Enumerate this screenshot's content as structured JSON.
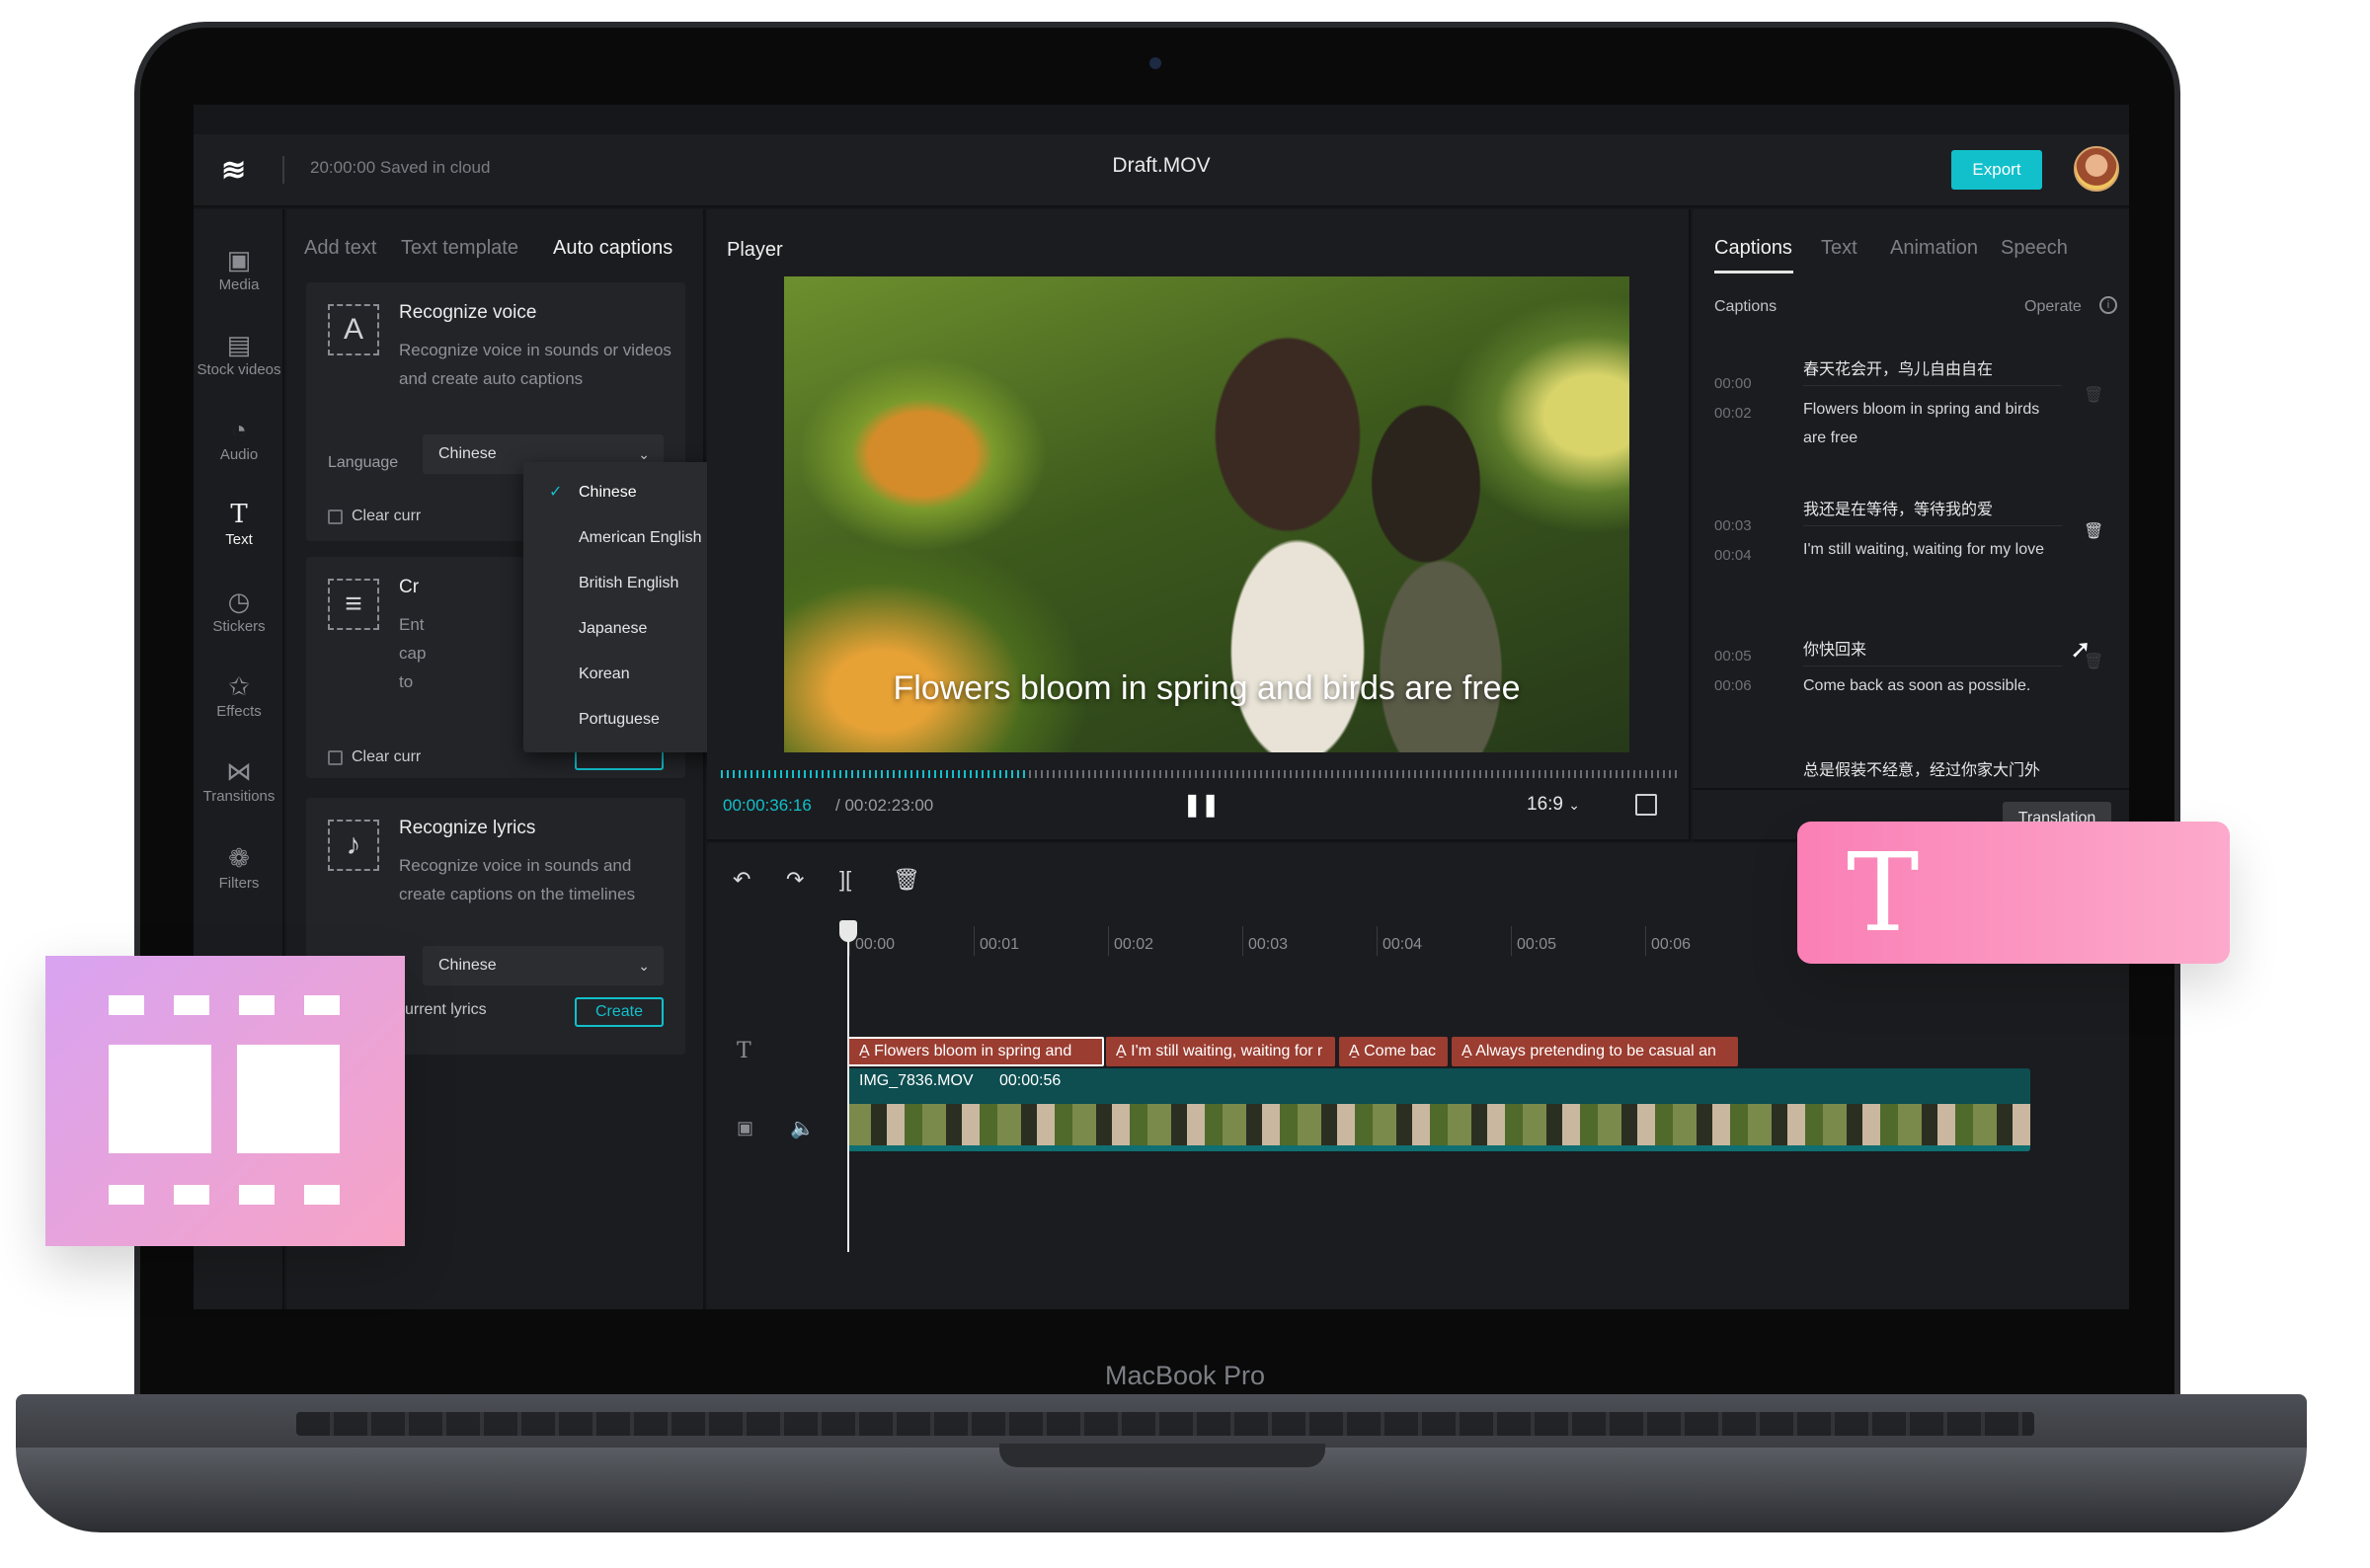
{
  "device": {
    "brand": "MacBook Pro"
  },
  "topbar": {
    "logo_icon": "capcut-logo-icon",
    "saved_status": "20:00:00 Saved in cloud",
    "title": "Draft.MOV",
    "export_label": "Export"
  },
  "rail": {
    "items": [
      {
        "label": "Media",
        "icon": "▣"
      },
      {
        "label": "Stock videos",
        "icon": "▤"
      },
      {
        "label": "Audio",
        "icon": "◔"
      },
      {
        "label": "Text",
        "icon": "T"
      },
      {
        "label": "Stickers",
        "icon": "◷"
      },
      {
        "label": "Effects",
        "icon": "✩"
      },
      {
        "label": "Transitions",
        "icon": "⋈"
      },
      {
        "label": "Filters",
        "icon": "❁"
      }
    ]
  },
  "text_panel": {
    "tabs": [
      "Add text",
      "Text template",
      "Auto captions"
    ],
    "recognize_voice": {
      "title": "Recognize voice",
      "desc": "Recognize voice in sounds or videos and create auto captions",
      "language_label": "Language",
      "language_value": "Chinese",
      "clear_label": "Clear curr"
    },
    "create_card": {
      "title": "Cr",
      "desc": "Ent cap to",
      "clear_label": "Clear curr"
    },
    "recognize_lyrics": {
      "title": "Recognize lyrics",
      "desc": "Recognize voice in sounds and create captions on the timelines",
      "language_value": "Chinese",
      "clear_label": "urrent lyrics",
      "create_label": "Create"
    },
    "language_menu": [
      "Chinese",
      "American English",
      "British English",
      "Japanese",
      "Korean",
      "Portuguese"
    ]
  },
  "player": {
    "title": "Player",
    "caption": "Flowers bloom in spring and birds are free",
    "time_current": "00:00:36:16",
    "time_total": "/ 00:02:23:00",
    "aspect_ratio": "16:9",
    "progress": 0.32
  },
  "captions_panel": {
    "tabs": [
      "Captions",
      "Text",
      "Animation",
      "Speech"
    ],
    "section_label": "Captions",
    "operate_label": "Operate",
    "items": [
      {
        "start": "00:00",
        "end": "00:02",
        "zh": "春天花会开，鸟儿自由自在",
        "en": "Flowers bloom in spring and birds are free"
      },
      {
        "start": "00:03",
        "end": "00:04",
        "zh": "我还是在等待，等待我的爱",
        "en": "I'm still waiting, waiting for my love"
      },
      {
        "start": "00:05",
        "end": "00:06",
        "zh": "你快回来",
        "en": "Come back as soon as possible."
      },
      {
        "zh": "总是假装不经意，经过你家大门外"
      }
    ],
    "translation_label": "Translation"
  },
  "timeline": {
    "ruler": [
      "00:00",
      "00:01",
      "00:02",
      "00:03",
      "00:04",
      "00:05",
      "00:06"
    ],
    "text_clips": [
      "Flowers bloom in spring and",
      "I'm still waiting, waiting for r",
      "Come bac",
      "Always pretending to be casual an"
    ],
    "clip_icon": "A̱",
    "video_clip": {
      "name": "IMG_7836.MOV",
      "duration": "00:00:56"
    }
  },
  "colors": {
    "accent": "#11c0cb",
    "clip": "#9b3d31",
    "video_track": "#0e4e51",
    "text_card": "#fa7fb5",
    "film_card": "#d8a3f1"
  }
}
